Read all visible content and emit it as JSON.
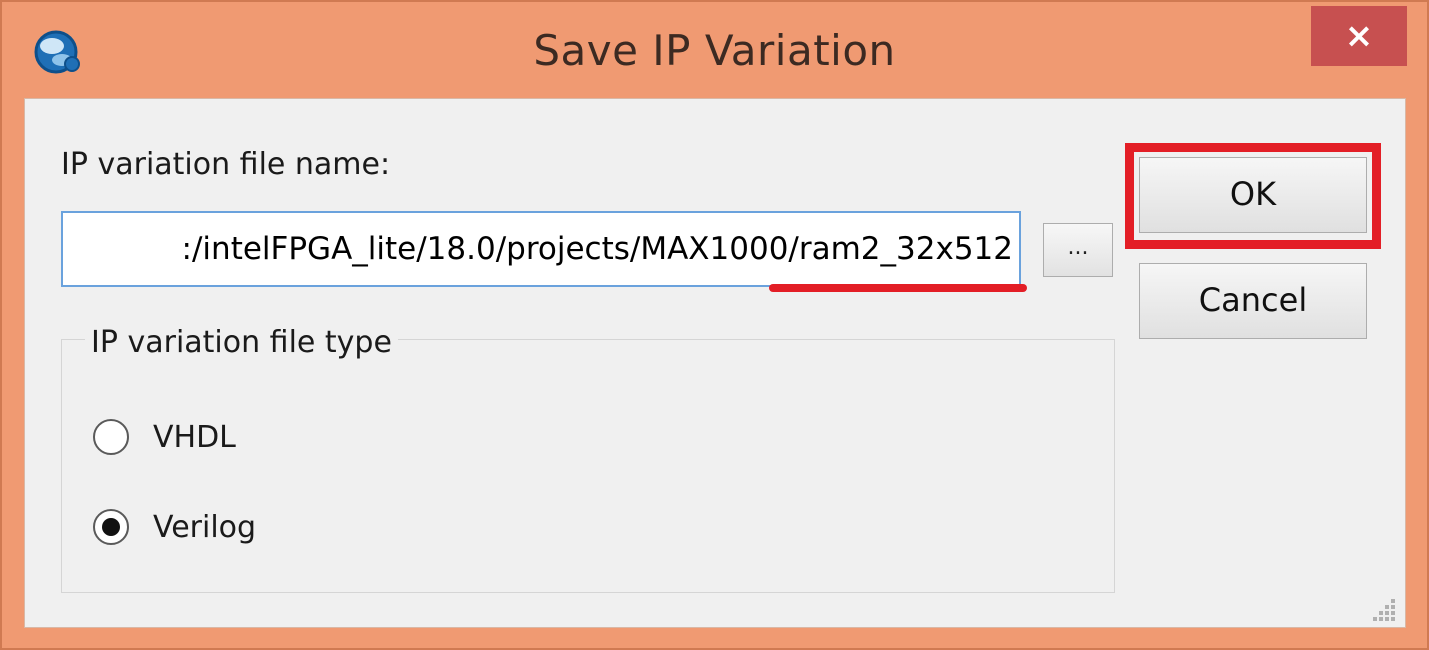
{
  "window": {
    "title": "Save IP Variation",
    "close_label": "×"
  },
  "form": {
    "file_name_label": "IP variation file name:",
    "file_name_value": ":/intelFPGA_lite/18.0/projects/MAX1000/ram2_32x512",
    "browse_label": "...",
    "file_type_group_label": "IP variation file type",
    "options": [
      {
        "label": "VHDL",
        "selected": false
      },
      {
        "label": "Verilog",
        "selected": true
      }
    ]
  },
  "buttons": {
    "ok_label": "OK",
    "cancel_label": "Cancel"
  },
  "colors": {
    "frame": "#f09a72",
    "close": "#c75050",
    "highlight": "#e31e26",
    "input_border": "#6aa2dd"
  }
}
